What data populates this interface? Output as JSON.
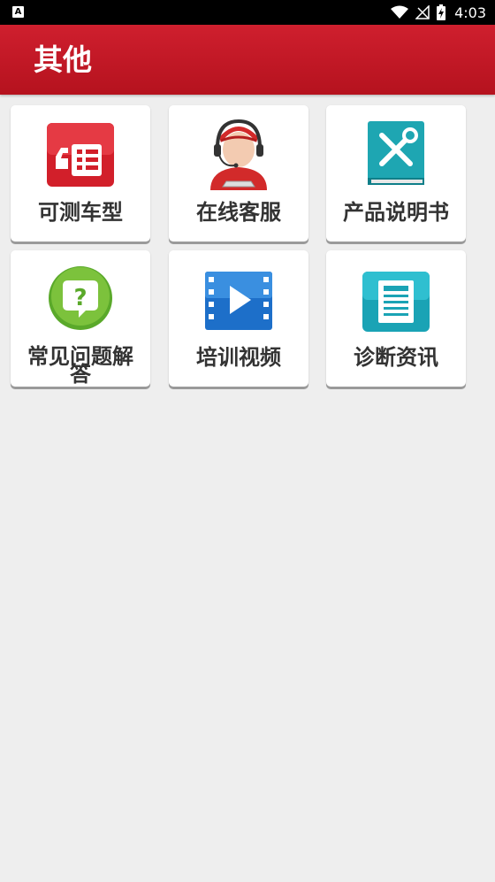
{
  "status_bar": {
    "notification_icon": "A",
    "time": "4:03"
  },
  "app_bar": {
    "title": "其他"
  },
  "tiles": [
    {
      "label": "可测车型",
      "icon": "car-list-icon"
    },
    {
      "label": "在线客服",
      "icon": "customer-service-agent-icon"
    },
    {
      "label": "产品说明书",
      "icon": "manual-book-icon"
    },
    {
      "label": "常见问题解答",
      "icon": "question-bubble-icon"
    },
    {
      "label": "培训视频",
      "icon": "video-play-icon"
    },
    {
      "label": "诊断资讯",
      "icon": "news-document-icon"
    }
  ],
  "colors": {
    "app_bar": "#c41a28",
    "background": "#eeeeee",
    "tile": "#ffffff"
  }
}
